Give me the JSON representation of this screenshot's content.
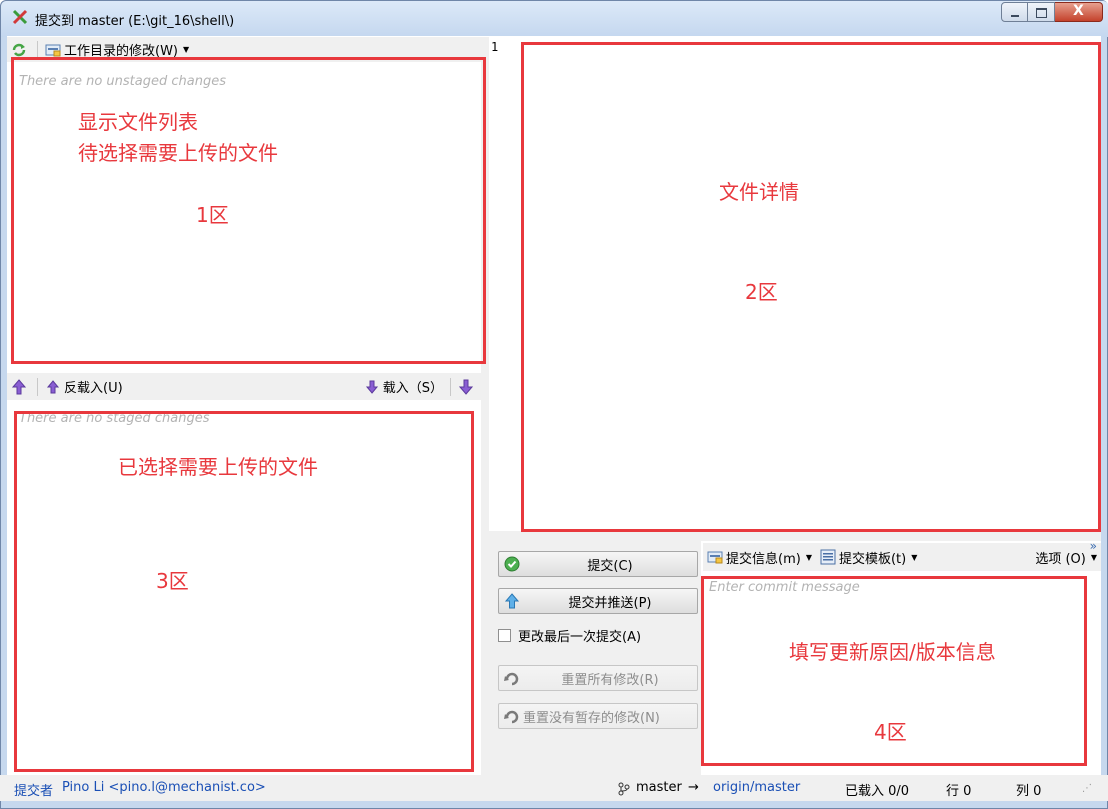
{
  "window": {
    "title": "提交到 master (E:\\git_16\\shell\\)",
    "close_glyph": "X"
  },
  "unstaged": {
    "toolbar_label": "工作目录的修改(W)",
    "placeholder": "There are no unstaged changes"
  },
  "staged": {
    "unstage_label": "反载入(U)",
    "stage_label": "载入（S）",
    "placeholder": "There are no staged changes"
  },
  "diff": {
    "line_number": "1"
  },
  "commit": {
    "commit_button": "提交(C)",
    "commit_push_button": "提交并推送(P)",
    "amend_label": "更改最后一次提交(A)",
    "reset_all_button": "重置所有修改(R)",
    "reset_unstaged_button": "重置没有暂存的修改(N)",
    "message_menu": "提交信息(m)",
    "template_menu": "提交模板(t)",
    "options_menu": "选项 (O)",
    "overflow_glyph": "»",
    "message_placeholder": "Enter commit message"
  },
  "annotations": {
    "area1_line1": "显示文件列表",
    "area1_line2": "待选择需要上传的文件",
    "area1_label": "1区",
    "area2_title": "文件详情",
    "area2_label": "2区",
    "area3_title": "已选择需要上传的文件",
    "area3_label": "3区",
    "area4_title": "填写更新原因/版本信息",
    "area4_label": "4区"
  },
  "status": {
    "committer_prefix": "提交者",
    "committer": "Pino Li <pino.l@mechanist.co>",
    "branch": "master",
    "arrow": "→",
    "remote_branch": "origin/master",
    "staged_count": "已载入  0/0",
    "row": "行  0",
    "col": "列  0"
  },
  "colors": {
    "annotation_red": "#e8383d",
    "link_blue": "#1a4fb5"
  }
}
